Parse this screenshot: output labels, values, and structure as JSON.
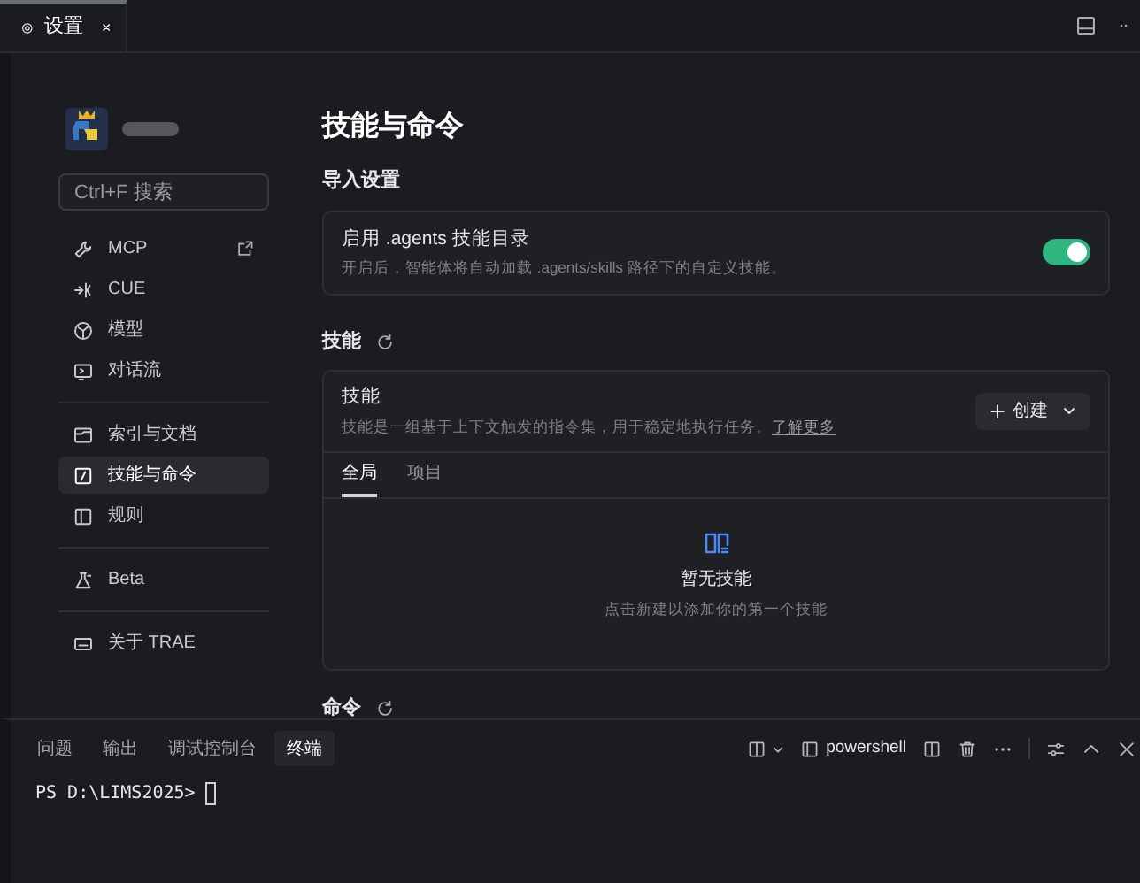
{
  "editor_tab": {
    "title": "设置",
    "selected": true
  },
  "sidebar": {
    "search": {
      "placeholder": "Ctrl+F 搜索"
    },
    "groups": [
      [
        {
          "label": "MCP",
          "selected": false,
          "external": true
        },
        {
          "label": "CUE",
          "selected": false,
          "external": false
        },
        {
          "label": "模型",
          "selected": false,
          "external": false
        },
        {
          "label": "对话流",
          "selected": false,
          "external": false
        }
      ],
      [
        {
          "label": "索引与文档",
          "selected": false,
          "external": false
        },
        {
          "label": "技能与命令",
          "selected": true,
          "external": false
        },
        {
          "label": "规则",
          "selected": false,
          "external": false
        }
      ],
      [
        {
          "label": "Beta",
          "selected": false,
          "external": false
        }
      ],
      [
        {
          "label": "关于 TRAE",
          "selected": false,
          "external": false
        }
      ]
    ]
  },
  "page": {
    "title": "技能与命令",
    "import_section": {
      "heading": "导入设置",
      "setting": {
        "label": "启用 .agents 技能目录",
        "description": "开启后，智能体将自动加载 .agents/skills 路径下的自定义技能。",
        "on": true
      }
    },
    "skills_section": {
      "heading": "技能",
      "card": {
        "title": "技能",
        "description": "技能是一组基于上下文触发的指令集，用于稳定地执行任务。",
        "link": "了解更多",
        "create_button": "创建",
        "tabs": [
          {
            "label": "全局",
            "selected": true
          },
          {
            "label": "项目",
            "selected": false
          }
        ],
        "empty_title": "暂无技能",
        "empty_hint": "点击新建以添加你的第一个技能"
      }
    },
    "commands_section": {
      "heading": "命令"
    }
  },
  "panel": {
    "tabs": [
      {
        "label": "问题",
        "selected": false
      },
      {
        "label": "输出",
        "selected": false
      },
      {
        "label": "调试控制台",
        "selected": false
      },
      {
        "label": "终端",
        "selected": true
      }
    ],
    "shell": "powershell",
    "prompt": "PS D:\\LIMS2025>"
  }
}
